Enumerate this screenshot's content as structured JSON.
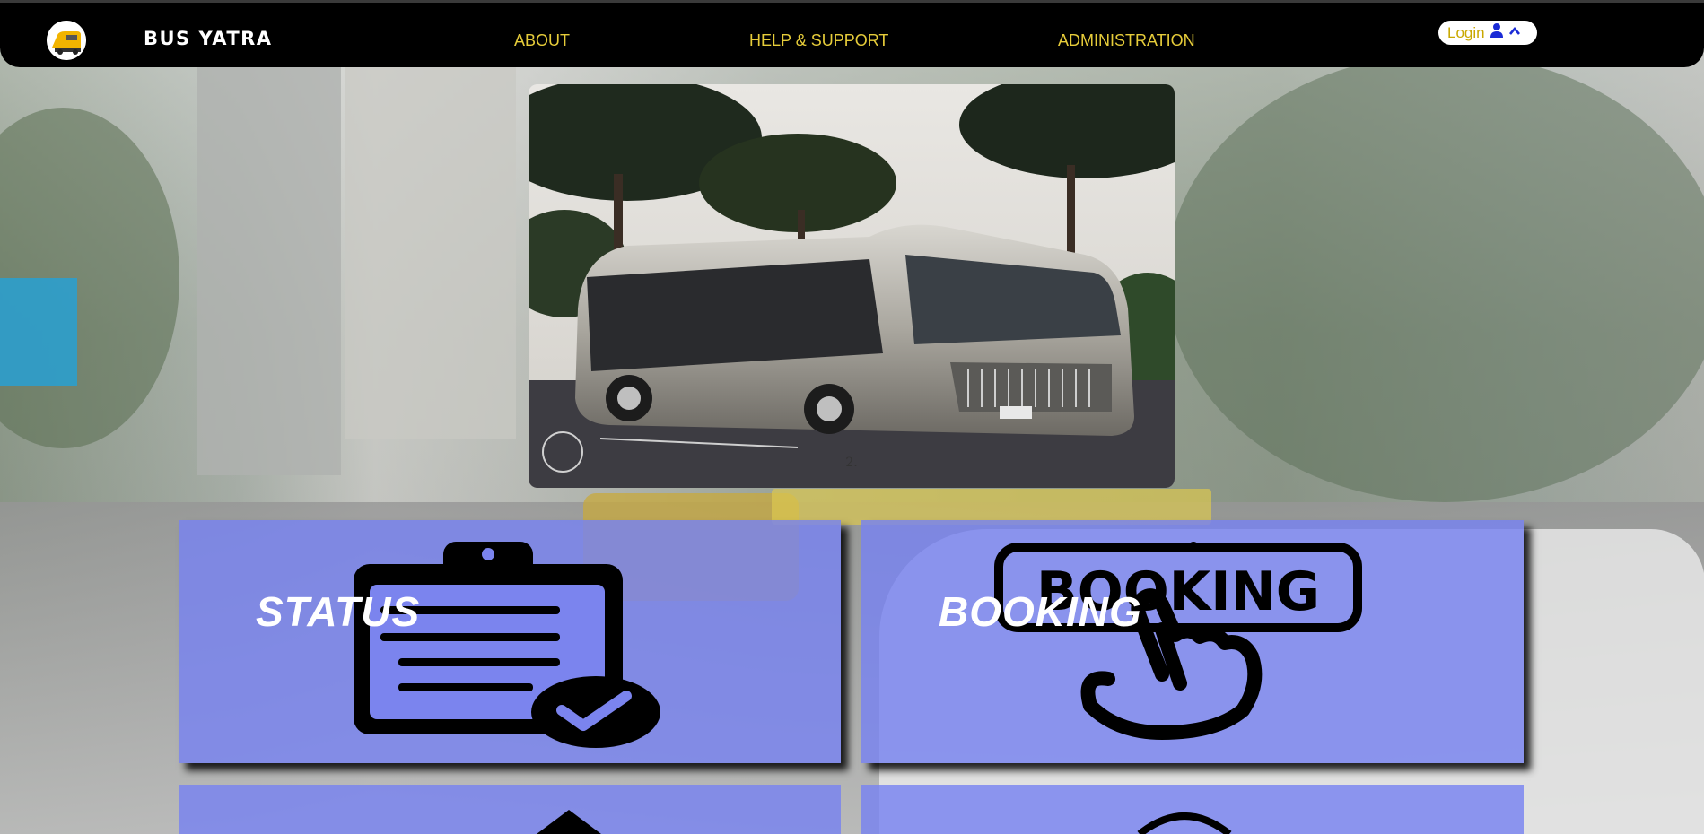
{
  "header": {
    "brand": "BUS YATRA",
    "nav": [
      {
        "label": "ABOUT"
      },
      {
        "label": "HELP & SUPPORT"
      },
      {
        "label": "ADMINISTRATION"
      }
    ],
    "login_label": "Login",
    "colors": {
      "background": "#000000",
      "nav_text": "#e6cc3a",
      "login_text": "#c9a800",
      "login_icon": "#1a2bd6"
    }
  },
  "hero": {
    "caption": "2."
  },
  "cards": [
    {
      "title": "STATUS",
      "icon": "clipboard-check-icon"
    },
    {
      "title": "BOOKING",
      "icon": "booking-hand-icon"
    }
  ],
  "accent": {
    "card_bg": "#7882f0"
  }
}
